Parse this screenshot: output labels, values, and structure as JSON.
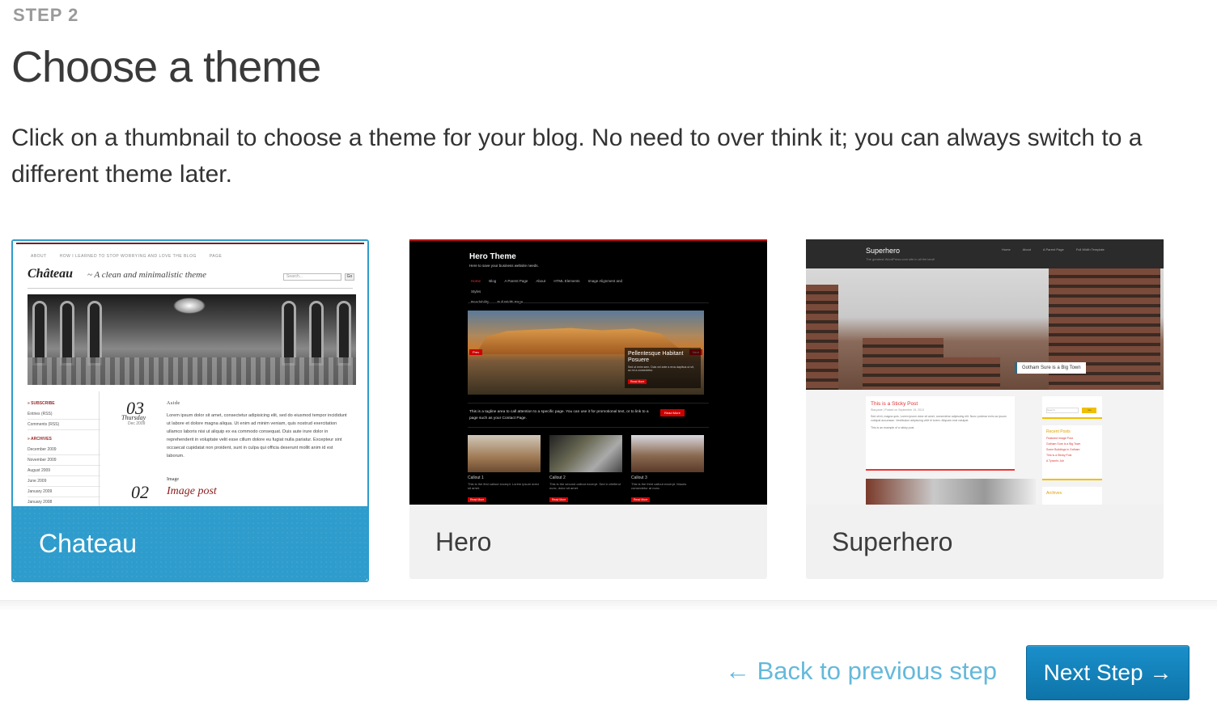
{
  "header": {
    "step_label": "STEP 2",
    "title": "Choose a theme",
    "intro": "Click on a thumbnail to choose a theme for your blog. No need to over think it; you can always switch to a different theme later."
  },
  "themes": [
    {
      "name": "Chateau",
      "selected": true,
      "preview": {
        "nav": [
          "ABOUT",
          "HOW I LEARNED TO STOP WORRYING AND LOVE THE BLOG",
          "PAGE"
        ],
        "brand": "Château",
        "tagline": "~ A clean and minimalistic theme",
        "search_placeholder": "Search...",
        "search_button": "Go",
        "sidebar_subscribe": "» SUBSCRIBE",
        "sidebar_subscribe_items": [
          "Entries (RSS)",
          "Comments (RSS)"
        ],
        "sidebar_archives": "» ARCHIVES",
        "sidebar_archive_items": [
          "December 2009",
          "November 2009",
          "August 2009",
          "June 2009",
          "January 2009",
          "January 2008"
        ],
        "post1_day": "03",
        "post1_weekday": "Thursday",
        "post1_date": "Dec 2009",
        "post1_type": "Aside",
        "post1_body": "Lorem ipsum dolor sit amet, consectetur adipisicing elit, sed do eiusmod tempor incididunt ut labore et dolore magna aliqua. Ut enim ad minim veniam, quis nostrud exercitation ullamco laboris nisi ut aliquip ex ea commodo consequat. Duis aute irure dolor in reprehenderit in voluptate velit esse cillum dolore eu fugiat nulla pariatur. Excepteur sint occaecat cupidatat non proident, sunt in culpa qui officia deserunt mollit anim id est laborum.",
        "post2_type": "Image",
        "post2_title": "Image post",
        "post2_day": "02"
      }
    },
    {
      "name": "Hero",
      "selected": false,
      "preview": {
        "title": "Hero Theme",
        "subtitle": "Here to save your business website needs.",
        "menu": [
          "Home",
          "Blog",
          "A Parent Page",
          "About",
          "HTML Elements",
          "Image Alignment and Styles",
          "Readability",
          "Full Width Page"
        ],
        "slide_prev": "Prev",
        "slide_next": "Next",
        "slide_caption": "Pellentesque Habitant Posuere",
        "slide_caption_text": "Sed ut enim sem. Duis vel ante a eros dapibus ut sit, ac mi a consectetur.",
        "slide_button": "Read More",
        "tagline": "This is a tagline area to call attention to a specific page. You can use it for promotional text, or to link to a page such as your Contact Page.",
        "tagline_button": "Read More",
        "callouts": [
          {
            "title": "Callout 1",
            "text": "This is the first callout excerpt. Lorem ipsum dolor sit amet.",
            "button": "Read More"
          },
          {
            "title": "Callout 2",
            "text": "This is the second callout excerpt. Sed in eleifend nunc, dolor sit amet.",
            "button": "Read More"
          },
          {
            "title": "Callout 3",
            "text": "This is the third callout excerpt. Mauris consectetur at nunc.",
            "button": "Read More"
          }
        ]
      }
    },
    {
      "name": "Superhero",
      "selected": false,
      "preview": {
        "logo": "Superhero",
        "description": "The greatest WordPress.com site in all the land!",
        "nav": [
          "Home",
          "About",
          "A Parent Page",
          "Full Width Template"
        ],
        "caption": "Gotham Sure is a Big Town",
        "post_title": "This is a Sticky Post",
        "post_meta": "Stacyane | Posted on September 19, 2013",
        "post_body": "Sed sit et, magna quis. Lorem ipsum dolor sit amet, consectetur adipiscing elit. Nunc pulvinar enim ac ipsum volutpat accumsan. Vestibulum adipiscing velit et lorem. Aliquam erat volutpat.",
        "post_footer": "This is an example of a sticky post.",
        "search_placeholder": "Search...",
        "search_button": "Go",
        "recent_posts_heading": "Recent Posts",
        "recent_posts": [
          "Featured Image Post",
          "Gotham Sure is a Big Town",
          "Some Buildings in Gotham",
          "This is a Sticky Post",
          "A Tyrant's Job"
        ],
        "archives_heading": "Archives"
      }
    }
  ],
  "footer": {
    "back_label": "← Back to previous step",
    "next_label": "Next Step →"
  },
  "colors": {
    "accent": "#2e9ccc",
    "link": "#65b9da",
    "button": "#1a8fcb"
  }
}
